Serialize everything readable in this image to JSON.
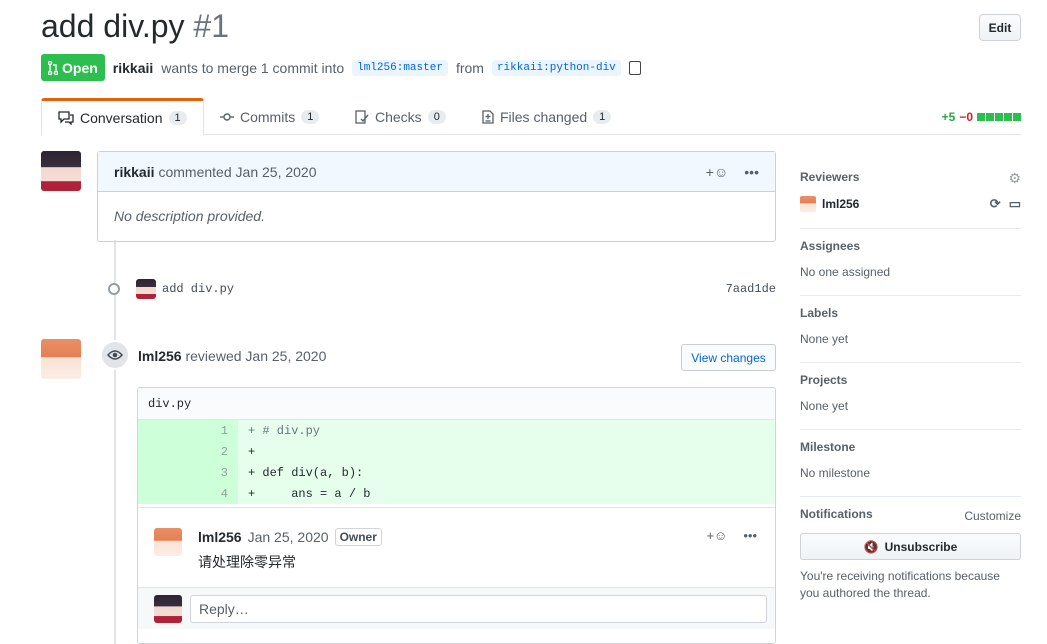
{
  "header": {
    "title": "add div.py",
    "number": "#1",
    "edit_label": "Edit"
  },
  "meta": {
    "state": "Open",
    "author": "rikkaii",
    "action_text": "wants to merge 1 commit into",
    "base_branch": "lml256:master",
    "from_text": "from",
    "head_branch": "rikkaii:python-div"
  },
  "tabs": [
    {
      "label": "Conversation",
      "count": "1"
    },
    {
      "label": "Commits",
      "count": "1"
    },
    {
      "label": "Checks",
      "count": "0"
    },
    {
      "label": "Files changed",
      "count": "1"
    }
  ],
  "diffstat": {
    "additions": "+5",
    "deletions": "−0",
    "add_color": "#28a745",
    "del_color": "#cb2431"
  },
  "comment": {
    "author": "rikkaii",
    "action": "commented",
    "date": "Jan 25, 2020",
    "body": "No description provided."
  },
  "commit": {
    "message": "add div.py",
    "sha": "7aad1de"
  },
  "review": {
    "author": "lml256",
    "action": "reviewed",
    "date": "Jan 25, 2020",
    "view_changes_label": "View changes",
    "file_name": "div.py",
    "lines": [
      {
        "num": "1",
        "text": "+ # div.py"
      },
      {
        "num": "2",
        "text": "+"
      },
      {
        "num": "3",
        "text": "+ def div(a, b):"
      },
      {
        "num": "4",
        "text": "+     ans = a / b"
      }
    ],
    "inline_comment": {
      "author": "lml256",
      "date": "Jan 25, 2020",
      "badge": "Owner",
      "body": "请处理除零异常"
    },
    "reply_placeholder": "Reply…"
  },
  "sidebar": {
    "reviewers_title": "Reviewers",
    "reviewer_name": "lml256",
    "assignees_title": "Assignees",
    "assignees_value": "No one assigned",
    "labels_title": "Labels",
    "labels_value": "None yet",
    "projects_title": "Projects",
    "projects_value": "None yet",
    "milestone_title": "Milestone",
    "milestone_value": "No milestone",
    "notifications_title": "Notifications",
    "customize_label": "Customize",
    "unsubscribe_label": "Unsubscribe",
    "notification_text": "You're receiving notifications because you authored the thread."
  },
  "colors": {
    "accent_green": "#2cbe4e",
    "link_blue": "#0366d6",
    "tab_orange": "#e36209"
  }
}
